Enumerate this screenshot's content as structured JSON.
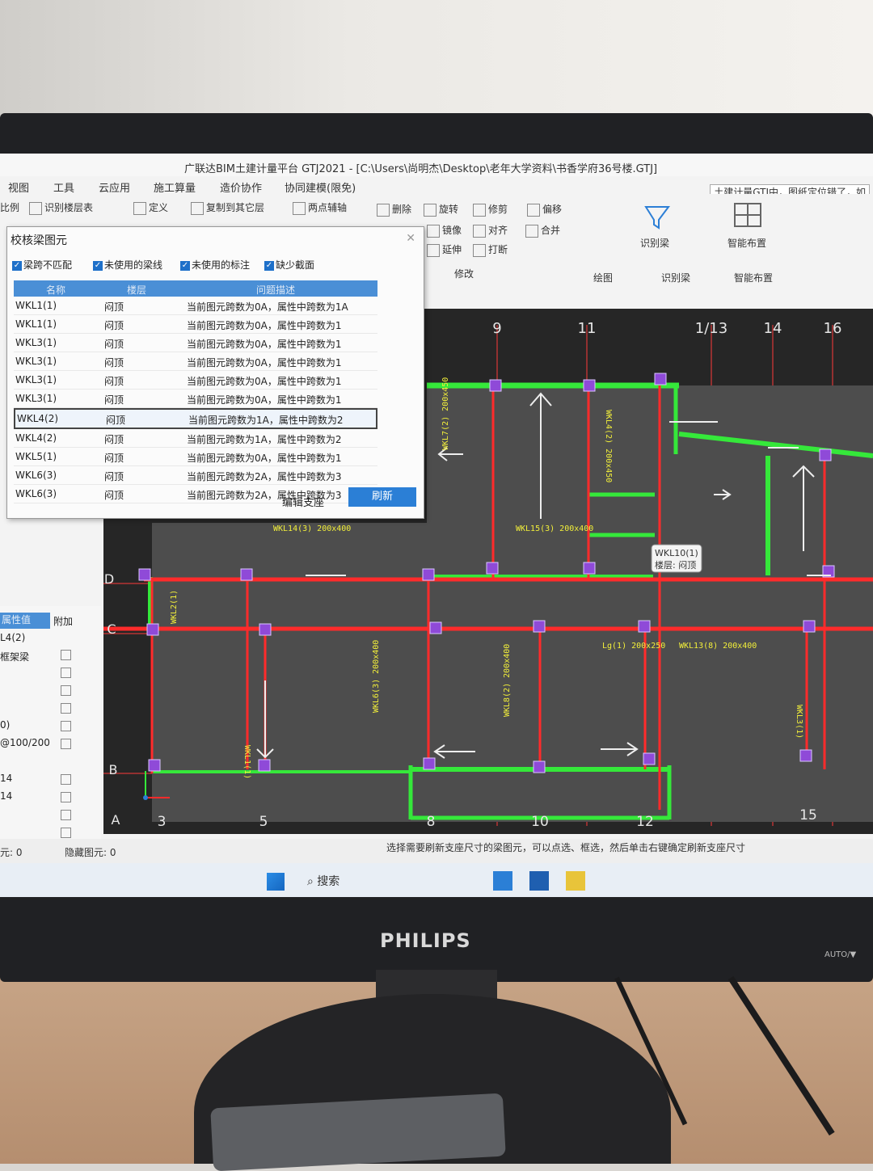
{
  "window": {
    "title": "广联达BIM土建计量平台 GTJ2021 - [C:\\Users\\尚明杰\\Desktop\\老年大学资料\\书香学府36号楼.GTJ]",
    "right_notice": "土建计量GTJ中，图纸定位错了，如"
  },
  "menu": [
    "视图",
    "工具",
    "云应用",
    "施工算量",
    "造价协作",
    "协同建模(限免)"
  ],
  "ribbon": {
    "items": [
      "比例",
      "识别楼层表",
      "定义",
      "复制到其它层",
      "两点辅轴",
      "删除",
      "旋转",
      "修剪",
      "偏移",
      "镜像",
      "对齐",
      "合并",
      "延伸",
      "打断",
      "识别梁",
      "智能布置"
    ],
    "groups": [
      "修改",
      "绘图",
      "识别梁",
      "智能布置"
    ]
  },
  "dialog": {
    "title": "校核梁图元",
    "checks": [
      "梁跨不匹配",
      "未使用的梁线",
      "未使用的标注",
      "缺少截面"
    ],
    "columns": [
      "名称",
      "楼层",
      "问题描述"
    ],
    "rows": [
      {
        "name": "WKL1(1)",
        "floor": "闷顶",
        "desc": "当前图元跨数为0A，属性中跨数为1A"
      },
      {
        "name": "WKL1(1)",
        "floor": "闷顶",
        "desc": "当前图元跨数为0A，属性中跨数为1"
      },
      {
        "name": "WKL3(1)",
        "floor": "闷顶",
        "desc": "当前图元跨数为0A，属性中跨数为1"
      },
      {
        "name": "WKL3(1)",
        "floor": "闷顶",
        "desc": "当前图元跨数为0A，属性中跨数为1"
      },
      {
        "name": "WKL3(1)",
        "floor": "闷顶",
        "desc": "当前图元跨数为0A，属性中跨数为1"
      },
      {
        "name": "WKL3(1)",
        "floor": "闷顶",
        "desc": "当前图元跨数为0A，属性中跨数为1"
      },
      {
        "name": "WKL4(2)",
        "floor": "闷顶",
        "desc": "当前图元跨数为1A，属性中跨数为2"
      },
      {
        "name": "WKL4(2)",
        "floor": "闷顶",
        "desc": "当前图元跨数为1A，属性中跨数为2"
      },
      {
        "name": "WKL5(1)",
        "floor": "闷顶",
        "desc": "当前图元跨数为0A，属性中跨数为1"
      },
      {
        "name": "WKL6(3)",
        "floor": "闷顶",
        "desc": "当前图元跨数为2A，属性中跨数为3"
      },
      {
        "name": "WKL6(3)",
        "floor": "闷顶",
        "desc": "当前图元跨数为2A，属性中跨数为3"
      }
    ],
    "selected_row": 6,
    "edit_button": "编辑支座",
    "refresh_button": "刷新"
  },
  "props": {
    "header": "属性值",
    "header2": "附加",
    "values": [
      "L4(2)",
      "框架梁",
      "",
      "",
      "",
      "0)",
      "@100/200",
      "",
      "14",
      "14",
      "",
      ""
    ]
  },
  "canvas": {
    "axis_top": [
      "9",
      "11",
      "1/13",
      "14",
      "16"
    ],
    "axis_bottom": [
      "3",
      "5",
      "8",
      "10",
      "12",
      "15"
    ],
    "axis_left": [
      "D",
      "C",
      "B",
      "A"
    ],
    "tooltip": {
      "line1": "WKL10(1)",
      "line2": "楼层: 闷顶"
    },
    "beam_labels": [
      "WKL14(3) 200x400",
      "WKL15(3) 200x400",
      "WKL4(2) 200x450",
      "WKL7(2) 200x450",
      "WKL8(2) 200x400",
      "WKL6(3) 200x400",
      "WKL13(8) 200x400",
      "Lg(1) 200x250",
      "WKL3(1)",
      "WKL2(1)",
      "WKL1(1)"
    ],
    "colors": {
      "beam_green": "#35e83a",
      "beam_red": "#ff2b2b",
      "axis": "#ff3a3a",
      "column": "#8f4ad8",
      "text": "#f2ef3a"
    }
  },
  "status": {
    "left1": "元: 0",
    "left2": "隐藏图元: 0",
    "hint": "选择需要刷新支座尺寸的梁图元，可以点选、框选，然后单击右键确定刷新支座尺寸"
  },
  "taskbar": {
    "search": "搜索"
  },
  "monitor": {
    "brand": "PHILIPS",
    "auto": "AUTO/▼"
  }
}
